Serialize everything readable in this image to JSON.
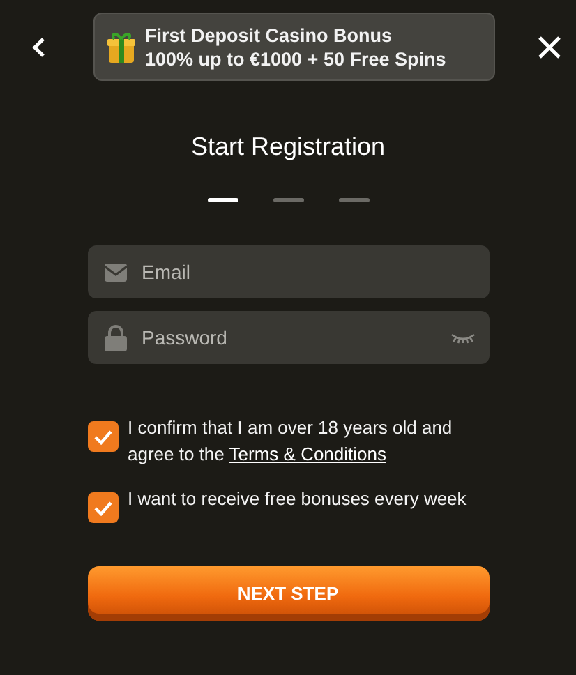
{
  "banner": {
    "title": "First Deposit Casino Bonus",
    "offer": "100% up to €1000 + 50 Free Spins"
  },
  "heading": "Start Registration",
  "steps": [
    {
      "selected": true
    },
    {
      "selected": false
    },
    {
      "selected": false
    }
  ],
  "fields": [
    {
      "kind": "email",
      "placeholder": "Email"
    },
    {
      "kind": "password",
      "placeholder": "Password"
    }
  ],
  "consents": [
    {
      "text": "I confirm that I am over 18 years old and agree to the",
      "link": "Terms & Conditions",
      "checked": true
    },
    {
      "text": "I want to receive free bonuses every week",
      "checked": true
    }
  ],
  "button": "NEXT STEP"
}
